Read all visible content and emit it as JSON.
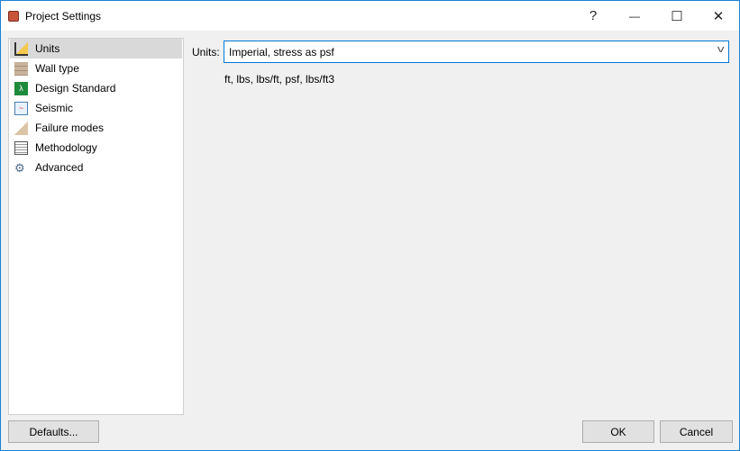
{
  "window": {
    "title": "Project Settings",
    "help": "?",
    "minimize": "—",
    "maximize": "☐",
    "close": "✕"
  },
  "sidebar": {
    "items": [
      {
        "label": "Units",
        "icon": "set-square-icon",
        "selected": true
      },
      {
        "label": "Wall type",
        "icon": "brick-wall-icon"
      },
      {
        "label": "Design Standard",
        "icon": "book-lambda-icon"
      },
      {
        "label": "Seismic",
        "icon": "seismograph-icon"
      },
      {
        "label": "Failure modes",
        "icon": "slope-icon"
      },
      {
        "label": "Methodology",
        "icon": "calculator-icon"
      },
      {
        "label": "Advanced",
        "icon": "gears-icon"
      }
    ]
  },
  "main": {
    "units_label": "Units:",
    "units_value": "Imperial, stress as psf",
    "units_description": "ft, lbs, lbs/ft, psf, lbs/ft3"
  },
  "buttons": {
    "defaults": "Defaults...",
    "ok": "OK",
    "cancel": "Cancel"
  }
}
